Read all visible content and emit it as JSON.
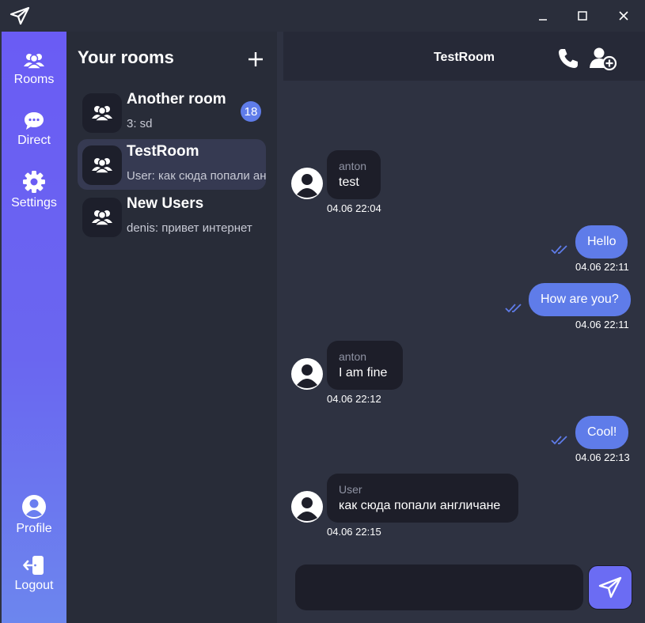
{
  "nav": {
    "rooms_label": "Rooms",
    "direct_label": "Direct",
    "settings_label": "Settings",
    "profile_label": "Profile",
    "logout_label": "Logout"
  },
  "rooms_panel": {
    "title": "Your rooms",
    "rooms": [
      {
        "name": "Another room",
        "last_message": "3: sd",
        "unread": "18"
      },
      {
        "name": "TestRoom",
        "last_message": "User: как сюда попали англичане",
        "unread": ""
      },
      {
        "name": "New Users",
        "last_message": "denis: привет интернет",
        "unread": ""
      }
    ]
  },
  "chat": {
    "title": "TestRoom",
    "messages": [
      {
        "direction": "in",
        "author": "anton",
        "text": "test",
        "time": "04.06 22:04"
      },
      {
        "direction": "out",
        "text": "Hello",
        "time": "04.06 22:11"
      },
      {
        "direction": "out",
        "text": "How are you?",
        "time": "04.06 22:11"
      },
      {
        "direction": "in",
        "author": "anton",
        "text": "I am fine",
        "time": "04.06 22:12"
      },
      {
        "direction": "out",
        "text": "Cool!",
        "time": "04.06 22:13"
      },
      {
        "direction": "in",
        "author": "User",
        "text": "как сюда попали англичане",
        "time": "04.06 22:15"
      }
    ],
    "composer_value": ""
  },
  "colors": {
    "accent": "#5f7ce9",
    "nav_gradient_top": "#6a5cf4",
    "nav_gradient_bottom": "#6c86ee",
    "incoming_bubble": "#1d1e29",
    "background": "#2e3241"
  },
  "icons": {
    "app": "paper-plane-icon",
    "rooms": "users-icon",
    "direct": "chat-bubble-icon",
    "settings": "gear-icon",
    "profile": "user-circle-icon",
    "logout": "logout-icon",
    "add_room": "plus-icon",
    "call": "phone-icon",
    "add_user": "user-plus-icon",
    "send": "send-icon",
    "read": "double-check-icon"
  }
}
